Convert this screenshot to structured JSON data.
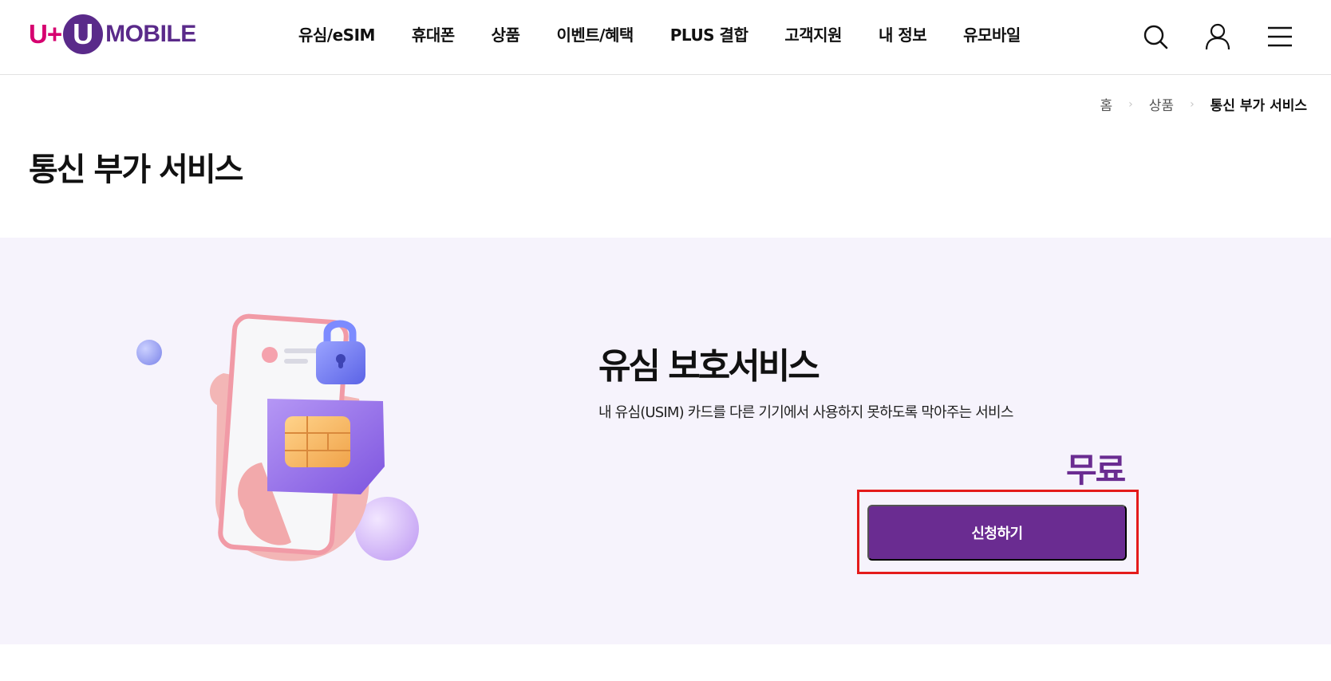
{
  "header": {
    "logo": {
      "brand": "U+",
      "mark": "U",
      "word": "MOBILE"
    },
    "nav": [
      {
        "label": "유심/eSIM"
      },
      {
        "label": "휴대폰"
      },
      {
        "label": "상품"
      },
      {
        "label": "이벤트/혜택"
      },
      {
        "label": "PLUS 결합"
      },
      {
        "label": "고객지원"
      },
      {
        "label": "내 정보"
      },
      {
        "label": "유모바일"
      }
    ],
    "icons": [
      "search-icon",
      "user-icon",
      "menu-icon"
    ]
  },
  "breadcrumb": {
    "items": [
      {
        "label": "홈"
      },
      {
        "label": "상품"
      },
      {
        "label": "통신 부가 서비스"
      }
    ],
    "separator": "›"
  },
  "page": {
    "title": "통신 부가 서비스"
  },
  "service": {
    "title": "유심 보호서비스",
    "description": "내 유심(USIM) 카드를 다른 기기에서 사용하지 못하도록 막아주는 서비스",
    "price": "무료",
    "apply_label": "신청하기"
  },
  "colors": {
    "brand_purple": "#6a2c91",
    "brand_pink": "#d6006f",
    "hero_bg": "#f6f3fc",
    "highlight_frame": "#e41b1b"
  }
}
